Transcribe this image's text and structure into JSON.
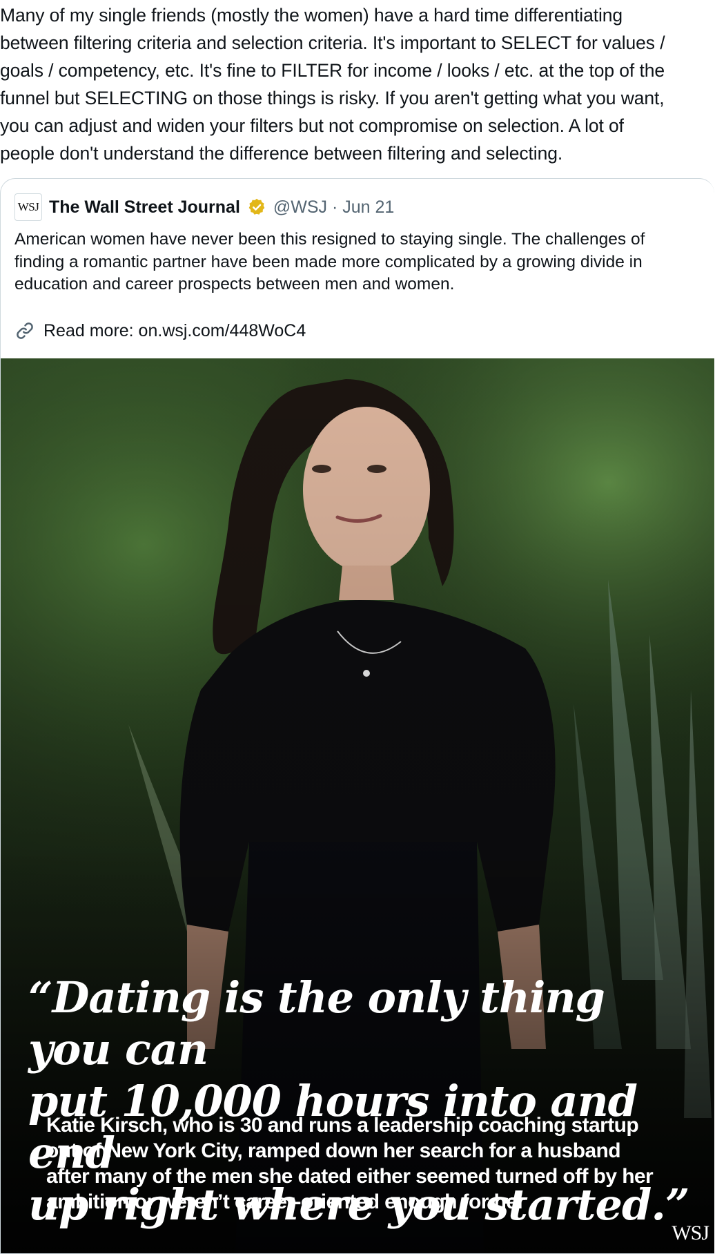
{
  "tweet": {
    "text": "Many of my single friends (mostly the women) have a hard time differentiating\nbetween filtering criteria and selection criteria. It's important to SELECT for values /\ngoals / competency, etc. It's fine to FILTER for income / looks / etc. at the top of the\nfunnel but SELECTING on those things is risky. If you aren't getting what you want,\nyou can adjust and widen your filters but not compromise on selection. A lot of\npeople don't understand the difference between filtering and selecting."
  },
  "quoted": {
    "avatar_text": "WSJ",
    "author_name": "The Wall Street Journal",
    "handle_date": "@WSJ · Jun 21",
    "verified_color": "#e2b719",
    "body": "American women have never been this resigned to staying single. The challenges of finding a romantic partner have been made more complicated by a growing divide in education and career prospects between men and women.",
    "read_more": "Read more: on.wsj.com/448WoC4",
    "icons": {
      "verified": "verified-badge-icon",
      "link": "link-icon"
    }
  },
  "image": {
    "quote": "“Dating is the only thing you can\n put 10,000 hours into and end\n up right where you started.”",
    "caption": "Katie Kirsch, who is 30 and runs a leadership coaching startup\nout of New York City, ramped down her search for a husband\nafter many of the men she dated either seemed turned off by her\nambition or weren’t career-oriented enough for her",
    "logo": "WSJ"
  }
}
